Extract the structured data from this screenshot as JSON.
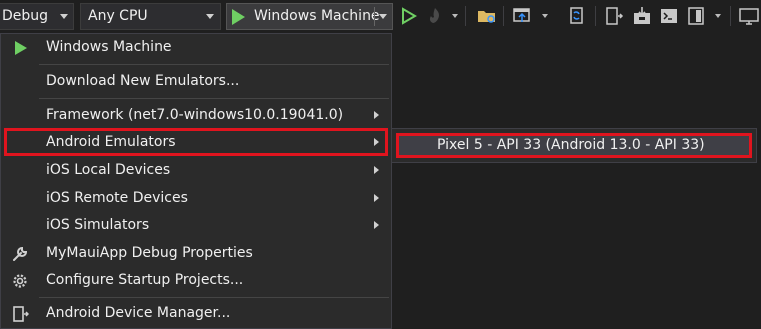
{
  "toolbar": {
    "configuration": "Debug",
    "platform": "Any CPU",
    "start_target": "Windows Machine",
    "icons": [
      "start-without-debugging-icon",
      "hot-reload-icon",
      "open-folder-icon",
      "browser-link-icon",
      "sync-icon",
      "device-icon",
      "install-icon",
      "terminal-icon",
      "panel-icon",
      "monitor-icon"
    ]
  },
  "menu": {
    "items": [
      {
        "label": "Windows Machine",
        "icon": "play-icon"
      },
      {
        "label": "Download New Emulators..."
      },
      {
        "label": "Framework (net7.0-windows10.0.19041.0)",
        "submenu": true
      },
      {
        "label": "Android Emulators",
        "submenu": true,
        "highlighted": true
      },
      {
        "label": "iOS Local Devices",
        "submenu": true
      },
      {
        "label": "iOS Remote Devices",
        "submenu": true
      },
      {
        "label": "iOS Simulators",
        "submenu": true
      },
      {
        "label": "MyMauiApp Debug Properties",
        "icon": "wrench-icon"
      },
      {
        "label": "Configure Startup Projects...",
        "icon": "gear-icon"
      },
      {
        "label": "Android Device Manager...",
        "icon": "device-manager-icon"
      }
    ]
  },
  "submenu": {
    "items": [
      {
        "label": "Pixel 5 - API 33 (Android 13.0 - API 33)",
        "highlighted": true
      }
    ]
  },
  "colors": {
    "background": "#1f1f1f",
    "menu_background": "#2b2b2b",
    "highlight_border": "#e0141e",
    "play_green": "#6fcf63"
  }
}
